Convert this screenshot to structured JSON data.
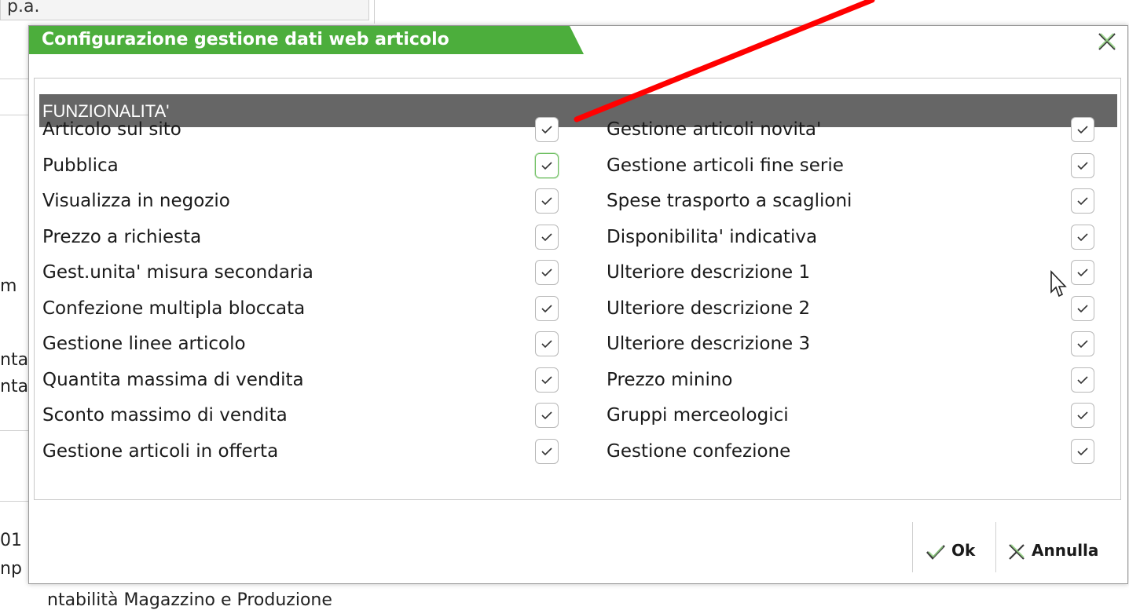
{
  "background": {
    "field_text": "p.a.",
    "fragments": [
      "m",
      "nta",
      "nta",
      "01",
      "np"
    ],
    "bottom_text": "ntabilità Magazzino e Produzione"
  },
  "dialog": {
    "title": "Configurazione gestione dati web articolo",
    "section_header": "FUNZIONALITA'",
    "left_items": [
      {
        "label": "Articolo sul sito",
        "checked": true
      },
      {
        "label": "Pubblica",
        "checked": true,
        "focused": true
      },
      {
        "label": "Visualizza in negozio",
        "checked": true
      },
      {
        "label": "Prezzo a richiesta",
        "checked": true
      },
      {
        "label": "Gest.unita' misura secondaria",
        "checked": true
      },
      {
        "label": "Confezione multipla bloccata",
        "checked": true
      },
      {
        "label": "Gestione linee articolo",
        "checked": true
      },
      {
        "label": "Quantita massima di vendita",
        "checked": true
      },
      {
        "label": "Sconto massimo di vendita",
        "checked": true
      },
      {
        "label": "Gestione articoli in offerta",
        "checked": true
      }
    ],
    "right_items": [
      {
        "label": "Gestione articoli novita'",
        "checked": true
      },
      {
        "label": "Gestione articoli fine serie",
        "checked": true
      },
      {
        "label": "Spese trasporto a scaglioni",
        "checked": true
      },
      {
        "label": "Disponibilita' indicativa",
        "checked": true
      },
      {
        "label": "Ulteriore descrizione 1",
        "checked": true
      },
      {
        "label": "Ulteriore descrizione 2",
        "checked": true
      },
      {
        "label": "Ulteriore descrizione 3",
        "checked": true
      },
      {
        "label": "Prezzo minino",
        "checked": true
      },
      {
        "label": "Gruppi merceologici",
        "checked": true
      },
      {
        "label": "Gestione confezione",
        "checked": true
      }
    ],
    "buttons": {
      "ok": "Ok",
      "cancel": "Annulla"
    }
  },
  "colors": {
    "title_green": "#4cae3c",
    "header_gray": "#666666",
    "annotation_red": "#ff0000"
  },
  "icons": [
    "close-icon",
    "checkmark-icon",
    "ok-check-icon",
    "cancel-x-icon",
    "mouse-cursor-icon"
  ]
}
